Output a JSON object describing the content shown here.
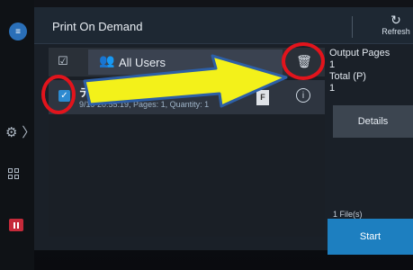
{
  "header": {
    "title": "Print On Demand",
    "refresh_label": "Refresh"
  },
  "list": {
    "filter_label": "All Users",
    "job": {
      "name": "テスト",
      "meta": "9/19 20:55:19, Pages: 1, Quantity: 1",
      "doc_badge": "F"
    }
  },
  "summary": {
    "output_pages_label": "Output Pages",
    "output_pages_value": "1",
    "total_label": "Total (P)",
    "total_value": "1",
    "details_label": "Details",
    "files_label": "1 File(s)",
    "start_label": "Start"
  },
  "colors": {
    "accent": "#1d7fc0",
    "annotation_red": "#e2141c",
    "arrow_yellow": "#f3f11a"
  }
}
